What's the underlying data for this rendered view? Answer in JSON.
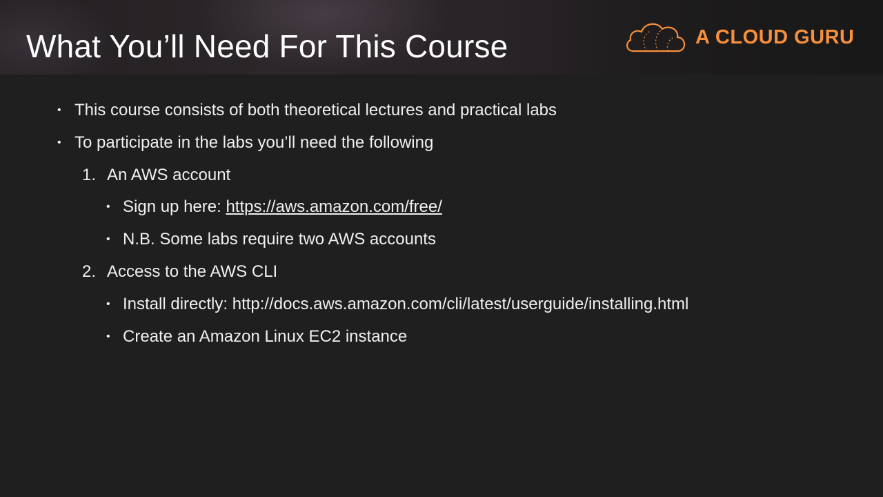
{
  "slide": {
    "title": "What You’ll Need For This Course",
    "brand": "A CLOUD GURU",
    "bullets": {
      "b1": "This course consists of both theoretical lectures and practical labs",
      "b2": "To participate in the labs you’ll need the following"
    },
    "steps": {
      "s1": {
        "number": "1.",
        "text": "An AWS account",
        "sub1_prefix": "Sign up here: ",
        "sub1_link": "https://aws.amazon.com/free/",
        "sub2": "N.B. Some labs require two AWS accounts"
      },
      "s2": {
        "number": "2.",
        "text": "Access to the AWS CLI",
        "sub1": "Install directly: http://docs.aws.amazon.com/cli/latest/userguide/installing.html",
        "sub2": "Create an Amazon Linux EC2 instance"
      }
    },
    "bullet_glyph": "•",
    "colors": {
      "background": "#1f1f1f",
      "text": "#f0f0f0",
      "brand_orange": "#f6903b"
    }
  }
}
